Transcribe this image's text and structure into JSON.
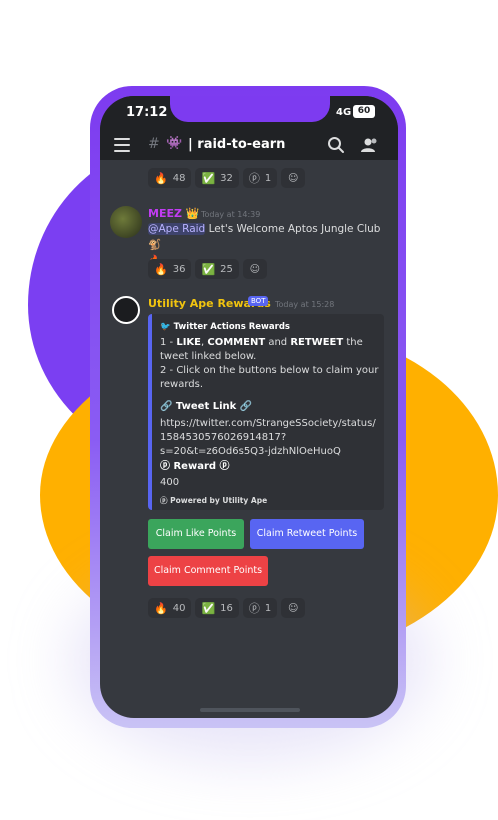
{
  "status": {
    "time": "17:12",
    "network": "4G",
    "battery": "60"
  },
  "channel": {
    "name": "raid-to-earn",
    "prefix_emoji": "👾"
  },
  "messages": {
    "top_reactions": [
      {
        "emoji": "🔥",
        "count": "48"
      },
      {
        "emoji": "✅",
        "count": "32"
      },
      {
        "emoji": "ⓟ",
        "count": "1"
      }
    ],
    "meez": {
      "author": "MEEZ",
      "author_badge": "👑",
      "timestamp": "Today at 14:39",
      "mention": "@Ape Raid",
      "text": " Let's Welcome Aptos Jungle Club 🐒",
      "text_line2": "🔥",
      "reactions": [
        {
          "emoji": "🔥",
          "count": "36"
        },
        {
          "emoji": "✅",
          "count": "25"
        }
      ]
    },
    "bot": {
      "author": "Utility Ape Rewards",
      "badge": "BOT",
      "timestamp": "Today at 15:28",
      "embed": {
        "header": "Twitter Actions Rewards",
        "line1_prefix": "1 - ",
        "line1_like": "LIKE",
        "line1_sep": ", ",
        "line1_comment": "COMMENT",
        "line1_and": " and ",
        "line1_retweet": "RETWEET",
        "line1_suffix": " the",
        "line1b": "tweet linked below.",
        "line2": "2 - Click on the buttons below to claim your",
        "line2b": "rewards.",
        "tweet_link_title": "🔗 Tweet Link 🔗",
        "url_line1": "https://twitter.com/StrangeSSociety/status/",
        "url_line2": "1584530576026914817?",
        "url_line3": "s=20&t=z6Od6s5Q3-jdzhNlOeHuoQ",
        "reward_title": "ⓟ Reward ⓟ",
        "reward_value": "400",
        "footer": "Powered by Utility Ape"
      },
      "buttons": {
        "like": "Claim Like Points",
        "retweet": "Claim Retweet Points",
        "comment": "Claim Comment Points"
      },
      "reactions": [
        {
          "emoji": "🔥",
          "count": "40"
        },
        {
          "emoji": "✅",
          "count": "16"
        },
        {
          "emoji": "ⓟ",
          "count": "1"
        }
      ]
    }
  },
  "colors": {
    "accent_purple": "#7d3bf0",
    "blob_orange": "#ffb000",
    "discord_bg": "#36393f",
    "blurple": "#5865f2",
    "green": "#3ba55c",
    "red": "#ed4245",
    "meez_name": "#c13cf3",
    "bot_name": "#f1c40f"
  }
}
